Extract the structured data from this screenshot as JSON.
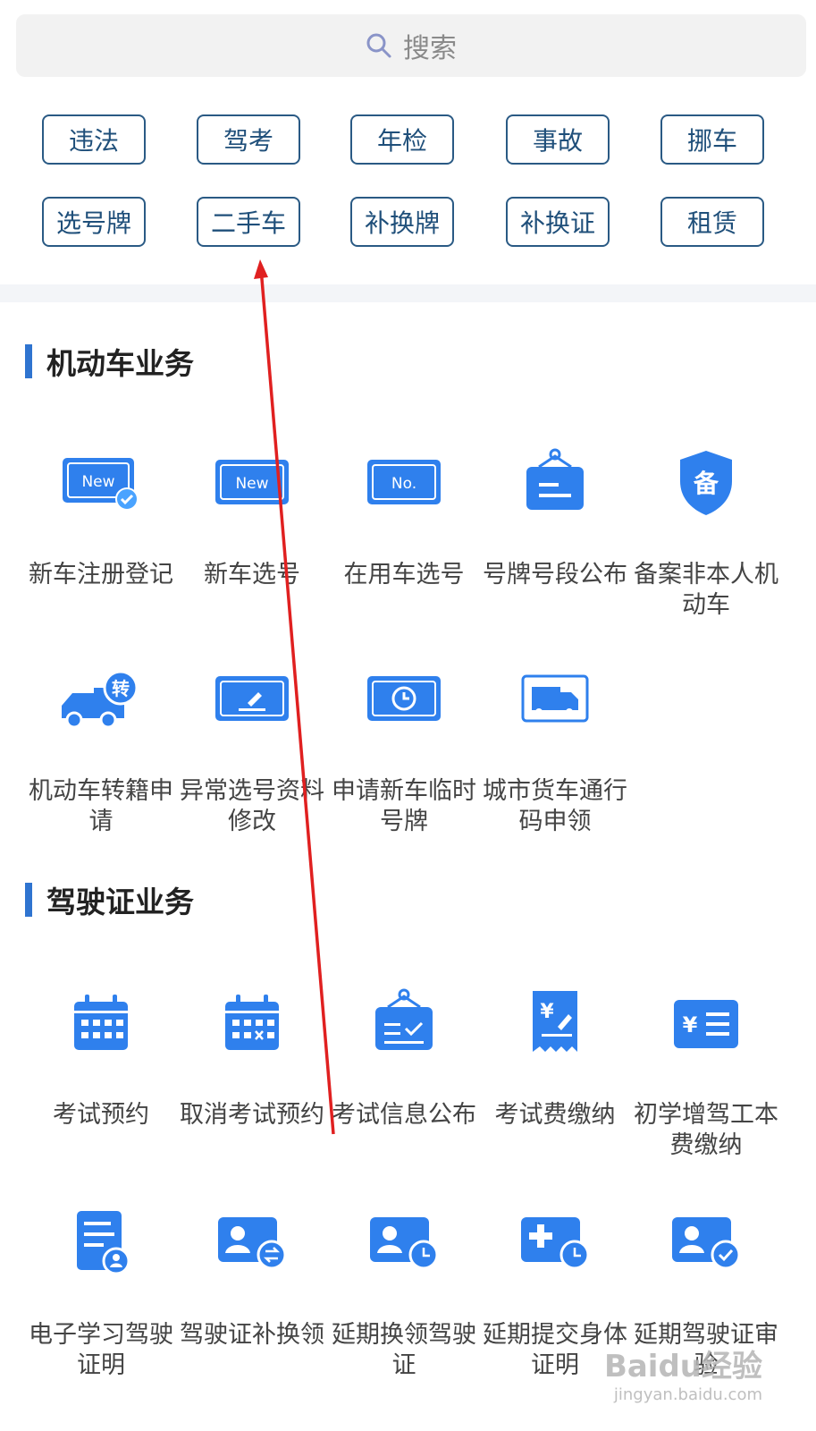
{
  "search": {
    "placeholder": "搜索"
  },
  "quick_tags": [
    [
      "违法",
      "驾考",
      "年检",
      "事故",
      "挪车"
    ],
    [
      "选号牌",
      "二手车",
      "补换牌",
      "补换证",
      "租赁"
    ]
  ],
  "sections": [
    {
      "title": "机动车业务",
      "items": [
        {
          "label": "新车注册登记",
          "icon": "new-plate-check-icon"
        },
        {
          "label": "新车选号",
          "icon": "new-plate-icon"
        },
        {
          "label": "在用车选号",
          "icon": "number-plate-icon"
        },
        {
          "label": "号牌号段公布",
          "icon": "hanging-sign-icon"
        },
        {
          "label": "备案非本人机动车",
          "icon": "shield-record-icon"
        },
        {
          "label": "机动车转籍申请",
          "icon": "truck-transfer-icon"
        },
        {
          "label": "异常选号资料修改",
          "icon": "plate-edit-icon"
        },
        {
          "label": "申请新车临时号牌",
          "icon": "plate-clock-icon"
        },
        {
          "label": "城市货车通行码申领",
          "icon": "truck-pass-icon"
        }
      ]
    },
    {
      "title": "驾驶证业务",
      "items": [
        {
          "label": "考试预约",
          "icon": "calendar-icon"
        },
        {
          "label": "取消考试预约",
          "icon": "calendar-cancel-icon"
        },
        {
          "label": "考试信息公布",
          "icon": "notice-board-icon"
        },
        {
          "label": "考试费缴纳",
          "icon": "fee-receipt-icon"
        },
        {
          "label": "初学增驾工本费缴纳",
          "icon": "fee-list-icon"
        },
        {
          "label": "电子学习驾驶证明",
          "icon": "document-user-icon"
        },
        {
          "label": "驾驶证补换领",
          "icon": "license-swap-icon"
        },
        {
          "label": "延期换领驾驶证",
          "icon": "license-clock-icon"
        },
        {
          "label": "延期提交身体证明",
          "icon": "health-clock-icon"
        },
        {
          "label": "延期驾驶证审验",
          "icon": "license-check-icon"
        }
      ]
    }
  ],
  "watermark": {
    "line1": "Baidu经验",
    "line2": "jingyan.baidu.com"
  },
  "colors": {
    "accent": "#2f74d0",
    "icon": "#2f80ed",
    "tag_border": "#2a5a84",
    "annotation": "#e02020"
  }
}
